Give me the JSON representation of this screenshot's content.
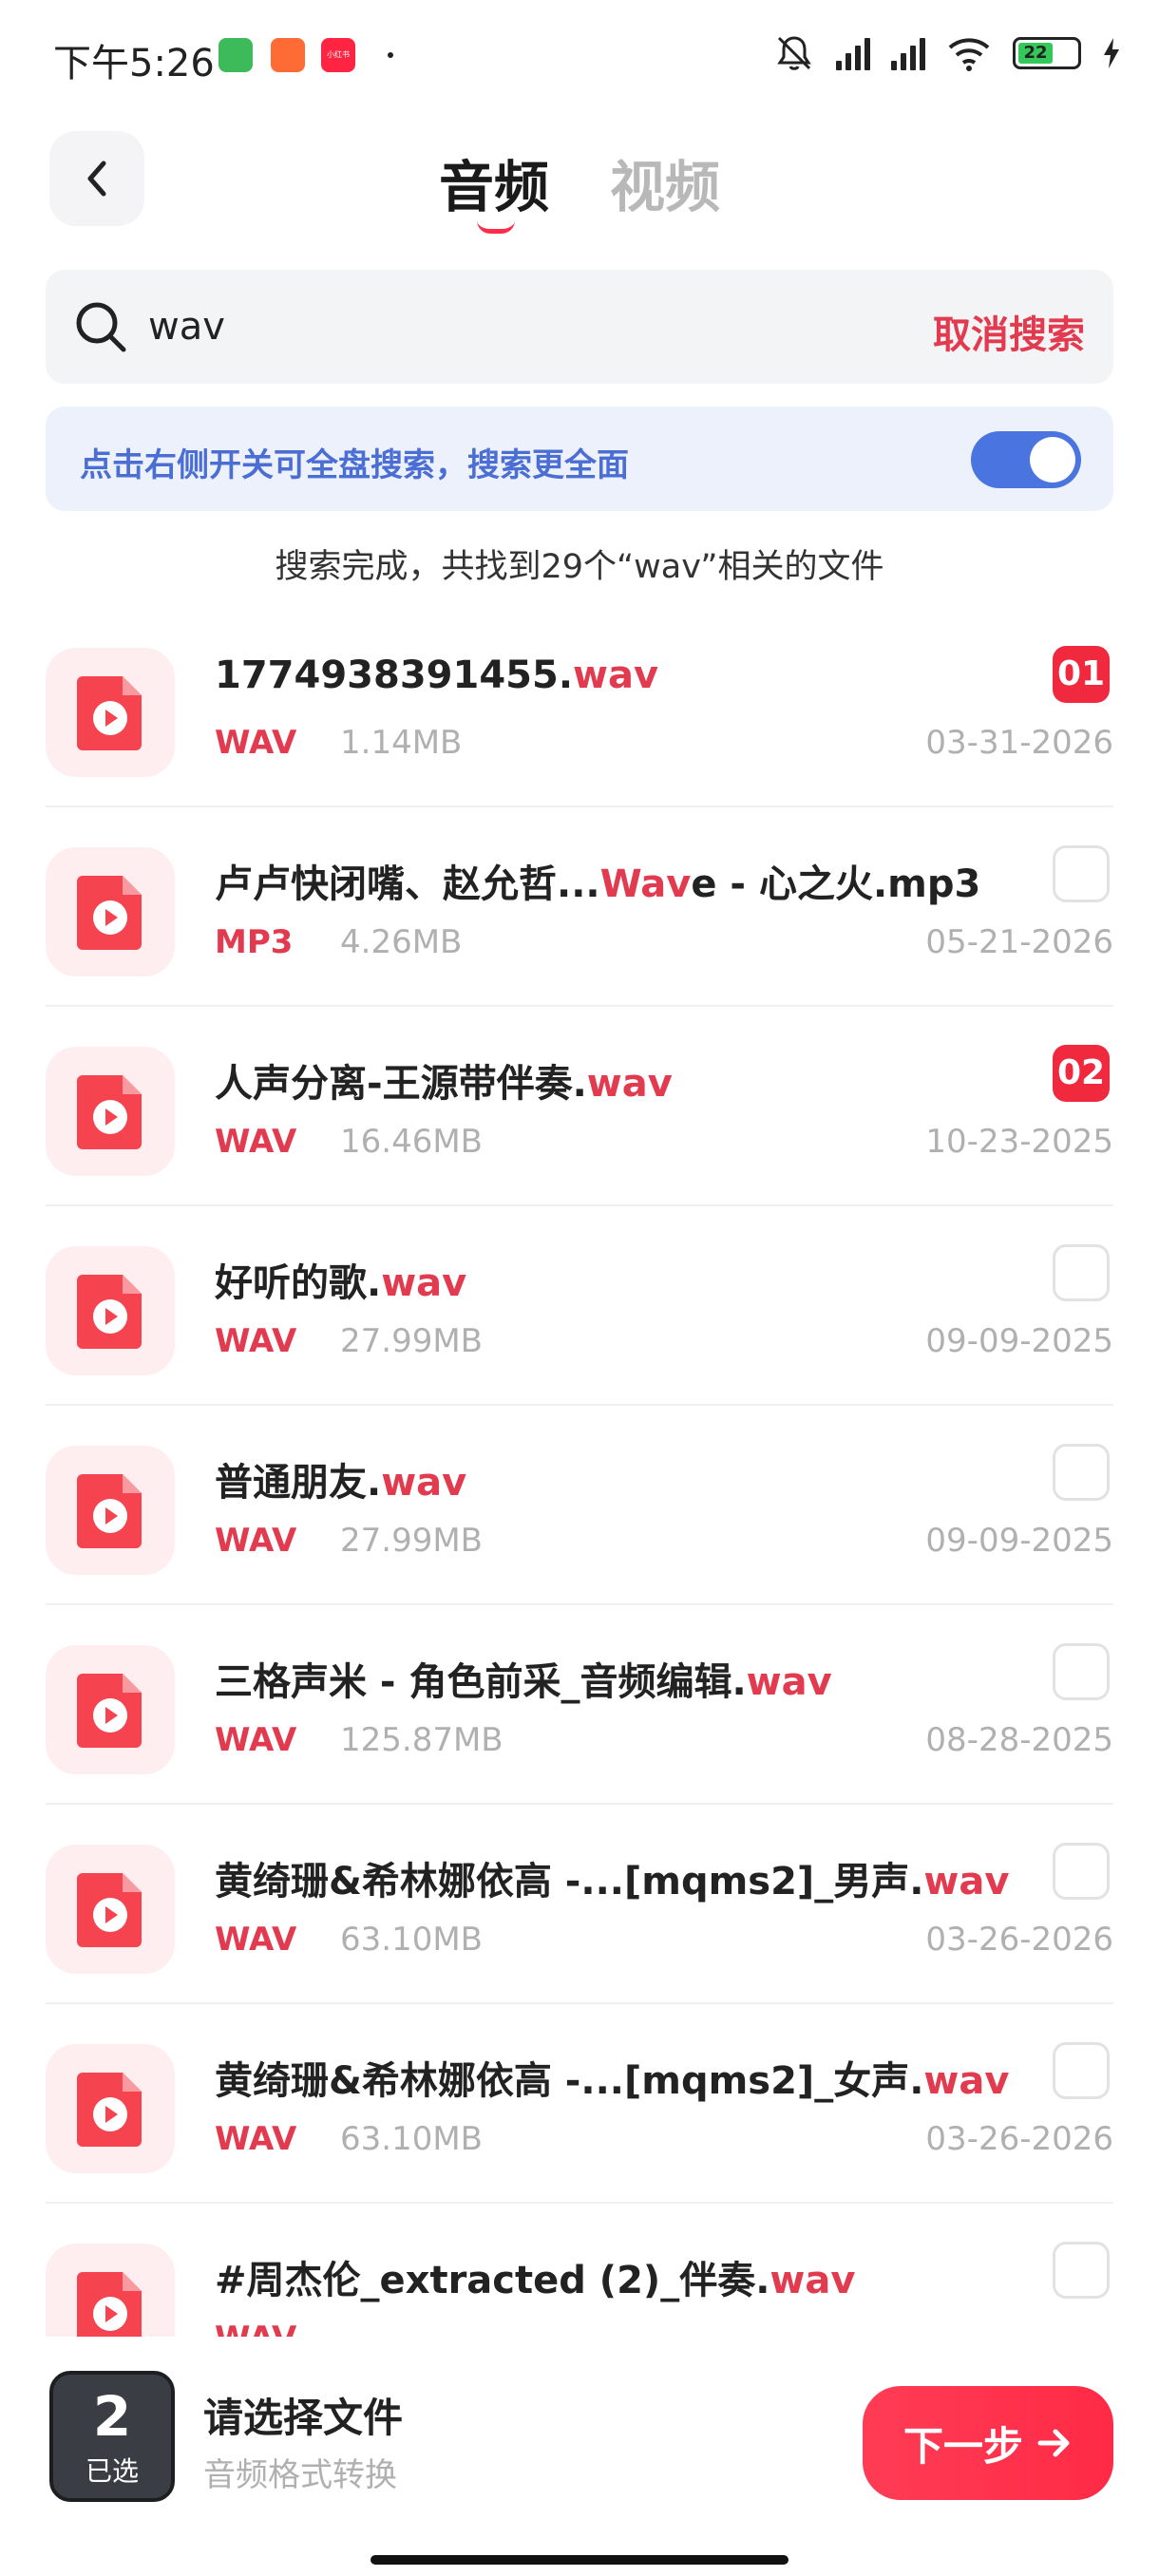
{
  "status_bar": {
    "time": "下午5:26",
    "battery": "22",
    "badge_3_text": "小红书"
  },
  "header": {
    "tabs": [
      {
        "label": "音频",
        "active": true
      },
      {
        "label": "视频",
        "active": false
      }
    ]
  },
  "search": {
    "value": "wav",
    "cancel_label": "取消搜索"
  },
  "banner": {
    "text": "点击右侧开关可全盘搜索，搜索更全面",
    "toggle_on": true
  },
  "result_summary": "搜索完成，共找到29个“wav”相关的文件",
  "files": [
    {
      "name_pre": "1774938391455.",
      "name_hl": "wav",
      "name_post": "",
      "type": "WAV",
      "size": "1.14MB",
      "date": "03-31-2026",
      "selected": "01"
    },
    {
      "name_pre": "卢卢快闭嘴、赵允哲...",
      "name_hl": "Wav",
      "name_post": "e - 心之火.mp3",
      "type": "MP3",
      "size": "4.26MB",
      "date": "05-21-2026",
      "selected": ""
    },
    {
      "name_pre": "人声分离-王源带伴奏.",
      "name_hl": "wav",
      "name_post": "",
      "type": "WAV",
      "size": "16.46MB",
      "date": "10-23-2025",
      "selected": "02"
    },
    {
      "name_pre": "好听的歌.",
      "name_hl": "wav",
      "name_post": "",
      "type": "WAV",
      "size": "27.99MB",
      "date": "09-09-2025",
      "selected": ""
    },
    {
      "name_pre": "普通朋友.",
      "name_hl": "wav",
      "name_post": "",
      "type": "WAV",
      "size": "27.99MB",
      "date": "09-09-2025",
      "selected": ""
    },
    {
      "name_pre": "三格声米 - 角色前采_音频编辑.",
      "name_hl": "wav",
      "name_post": "",
      "type": "WAV",
      "size": "125.87MB",
      "date": "08-28-2025",
      "selected": ""
    },
    {
      "name_pre": "黄绮珊&希林娜依高 -...[mqms2]_男声.",
      "name_hl": "wav",
      "name_post": "",
      "type": "WAV",
      "size": "63.10MB",
      "date": "03-26-2026",
      "selected": ""
    },
    {
      "name_pre": "黄绮珊&希林娜依高 -...[mqms2]_女声.",
      "name_hl": "wav",
      "name_post": "",
      "type": "WAV",
      "size": "63.10MB",
      "date": "03-26-2026",
      "selected": ""
    },
    {
      "name_pre": "#周杰伦_extracted (2)_伴奏.",
      "name_hl": "wav",
      "name_post": "",
      "type": "WAV",
      "size": "",
      "date": "",
      "selected": ""
    }
  ],
  "bottom_bar": {
    "count": "2",
    "count_label": "已选",
    "title": "请选择文件",
    "subtitle": "音频格式转换",
    "next_label": "下一步"
  },
  "colors": {
    "accent": "#e23a4e",
    "toggle": "#4a74e0",
    "banner_text": "#4b6ed4"
  }
}
